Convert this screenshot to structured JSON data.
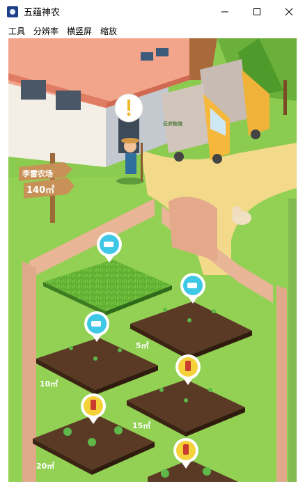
{
  "window": {
    "title": "五蕴神农",
    "minimize_glyph": "—",
    "maximize_glyph": "□",
    "close_glyph": "✕"
  },
  "menu": [
    "工具",
    "分辨率",
    "横竖屏",
    "缩放"
  ],
  "signpost": {
    "name": "李雷农场",
    "area": "140㎡"
  },
  "truck_sign": "云农物流",
  "plots": [
    {
      "area": "",
      "action": "water",
      "icon": "watering-can-icon",
      "state": "grass"
    },
    {
      "area": "5㎡",
      "action": "water",
      "icon": "watering-can-icon",
      "state": "sprouts"
    },
    {
      "area": "10㎡",
      "action": "water",
      "icon": "watering-can-icon",
      "state": "sprouts"
    },
    {
      "area": "15㎡",
      "action": "fertilize",
      "icon": "spray-bottle-icon",
      "state": "sprouts"
    },
    {
      "area": "20㎡",
      "action": "fertilize",
      "icon": "spray-bottle-icon",
      "state": "seedlings"
    },
    {
      "area": "",
      "action": "fertilize",
      "icon": "spray-bottle-icon",
      "state": "seedlings"
    }
  ],
  "farmer_speech_icon": "exclamation-icon",
  "colors": {
    "grass": "#86c74a",
    "soil": "#5a3a25",
    "water_badge": "#3fc7e6",
    "spray_badge": "#f5d23a"
  }
}
